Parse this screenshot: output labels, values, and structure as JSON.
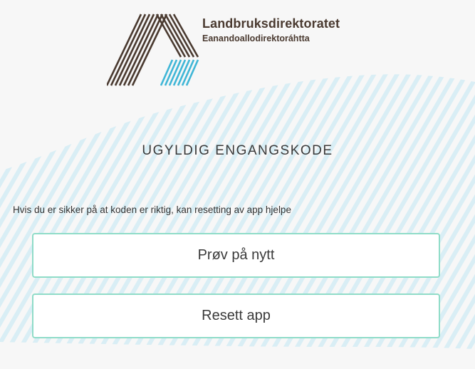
{
  "logo": {
    "title": "Landbruksdirektoratet",
    "subtitle": "Eanandoallodirektoráhtta",
    "brown": "#4a3a30",
    "blue": "#3fb6d6"
  },
  "heading": "UGYLDIG ENGANGSKODE",
  "info_text": "Hvis du er sikker på at koden er riktig, kan resetting av app hjelpe",
  "buttons": {
    "retry_label": "Prøv på nytt",
    "reset_label": "Resett app"
  },
  "colors": {
    "background": "#f7f7f7",
    "stripe": "#d6ecf3",
    "button_border": "#8fdcc8"
  }
}
